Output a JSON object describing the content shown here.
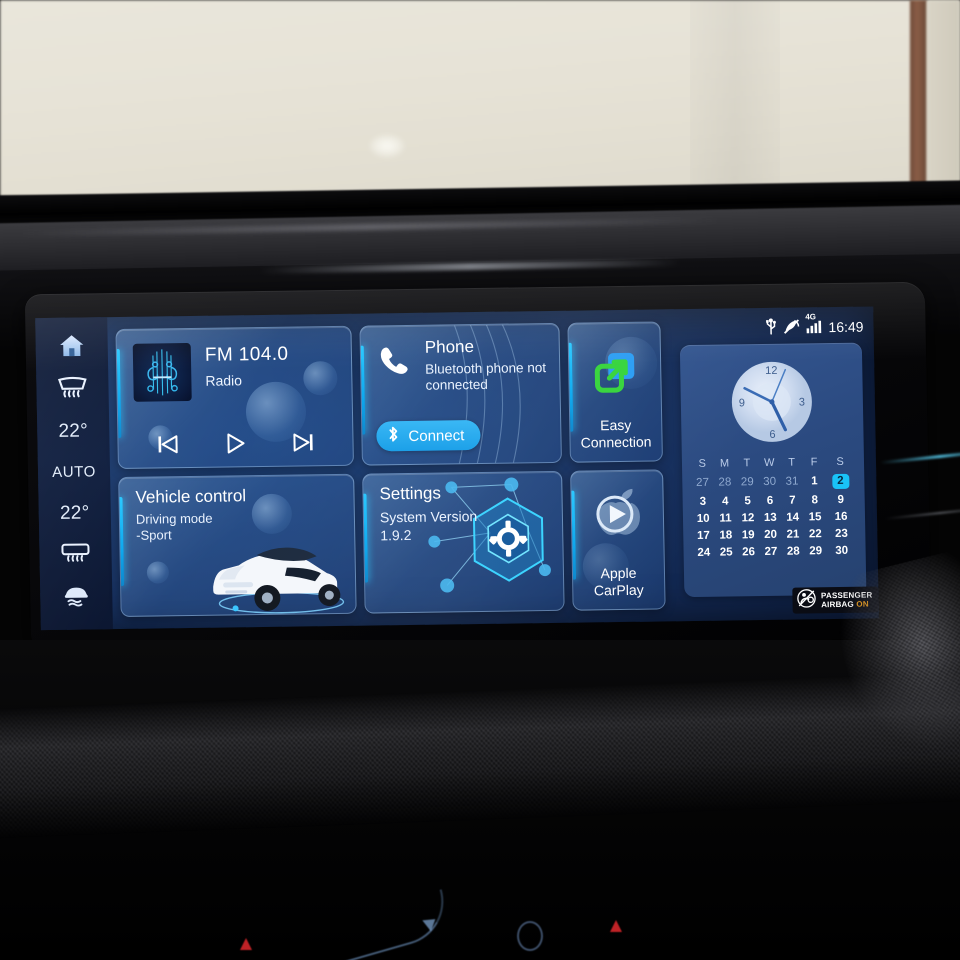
{
  "display": {
    "sidebar": {
      "items": [
        {
          "name": "home",
          "label": "",
          "icon": "home-icon"
        },
        {
          "name": "front-defrost",
          "label": "",
          "icon": "front-defrost-icon"
        },
        {
          "name": "driver-temp",
          "label": "22°",
          "icon": "temperature-value"
        },
        {
          "name": "auto-climate",
          "label": "AUTO",
          "icon": "auto-label"
        },
        {
          "name": "passenger-temp",
          "label": "22°",
          "icon": "temperature-value"
        },
        {
          "name": "rear-defrost",
          "label": "",
          "icon": "rear-defrost-icon"
        },
        {
          "name": "traction-control",
          "label": "",
          "icon": "traction-control-icon"
        }
      ]
    },
    "status_bar": {
      "usb_icon": "usb-icon",
      "gps_muted_icon": "gps-off-icon",
      "network_label": "4G",
      "signal_icon": "signal-bars-icon",
      "time": "16:49"
    },
    "tiles": {
      "radio": {
        "title": "FM  104.0",
        "subtitle": "Radio",
        "album_art": "violin-neon-art",
        "controls": [
          {
            "name": "previous-track-button",
            "icon": "skip-back-icon"
          },
          {
            "name": "play-button",
            "icon": "play-icon"
          },
          {
            "name": "next-track-button",
            "icon": "skip-forward-icon"
          }
        ]
      },
      "phone": {
        "title": "Phone",
        "status": "Bluetooth phone not connected",
        "button_label": "Connect",
        "button_icon": "bluetooth-icon",
        "phone_icon": "phone-handset-icon"
      },
      "easy_connection": {
        "label_line1": "Easy",
        "label_line2": "Connection",
        "icon": "screen-mirror-icon",
        "icon_color_front": "#35d43b",
        "icon_color_back": "#2a9df4"
      },
      "vehicle_control": {
        "title": "Vehicle control",
        "line1": "Driving mode",
        "line2": "-Sport",
        "illustration": "white-suv-illustration"
      },
      "settings": {
        "title": "Settings",
        "line1": "System Version",
        "line2": "1.9.2",
        "illustration": "gear-hexagon-network-icon"
      },
      "apple_carplay": {
        "label_line1": "Apple",
        "label_line2": "CarPlay",
        "icon": "carplay-icon"
      }
    },
    "widget": {
      "clock": {
        "markers": [
          "12",
          "3",
          "6",
          "9"
        ],
        "hour_hand_deg": 202,
        "minute_hand_deg": 294,
        "second_hand_deg": 20
      },
      "calendar": {
        "weekdays": [
          "S",
          "M",
          "T",
          "W",
          "T",
          "F",
          "S"
        ],
        "weeks": [
          [
            {
              "d": "27",
              "dim": true
            },
            {
              "d": "28",
              "dim": true
            },
            {
              "d": "29",
              "dim": true
            },
            {
              "d": "30",
              "dim": true
            },
            {
              "d": "31",
              "dim": true
            },
            {
              "d": "1"
            },
            {
              "d": "2",
              "selected": true
            }
          ],
          [
            {
              "d": "3"
            },
            {
              "d": "4"
            },
            {
              "d": "5"
            },
            {
              "d": "6"
            },
            {
              "d": "7"
            },
            {
              "d": "8"
            },
            {
              "d": "9"
            }
          ],
          [
            {
              "d": "10"
            },
            {
              "d": "11"
            },
            {
              "d": "12"
            },
            {
              "d": "13"
            },
            {
              "d": "14"
            },
            {
              "d": "15"
            },
            {
              "d": "16"
            }
          ],
          [
            {
              "d": "17"
            },
            {
              "d": "18"
            },
            {
              "d": "19"
            },
            {
              "d": "20"
            },
            {
              "d": "21"
            },
            {
              "d": "22"
            },
            {
              "d": "23"
            }
          ],
          [
            {
              "d": "24"
            },
            {
              "d": "25"
            },
            {
              "d": "26"
            },
            {
              "d": "27"
            },
            {
              "d": "28"
            },
            {
              "d": "29"
            },
            {
              "d": "30"
            }
          ]
        ]
      }
    },
    "airbag_indicator": {
      "line1": "PASSENGER",
      "line2": "AIRBAG",
      "state": "ON",
      "icon": "passenger-airbag-off-symbol",
      "state_color": "#f5a11a"
    },
    "colors": {
      "accent_cyan": "#27c8ff",
      "tile_blue": "#4a86cc",
      "background_navy": "#0d1c3c",
      "connect_blue": "#179ee8"
    }
  }
}
